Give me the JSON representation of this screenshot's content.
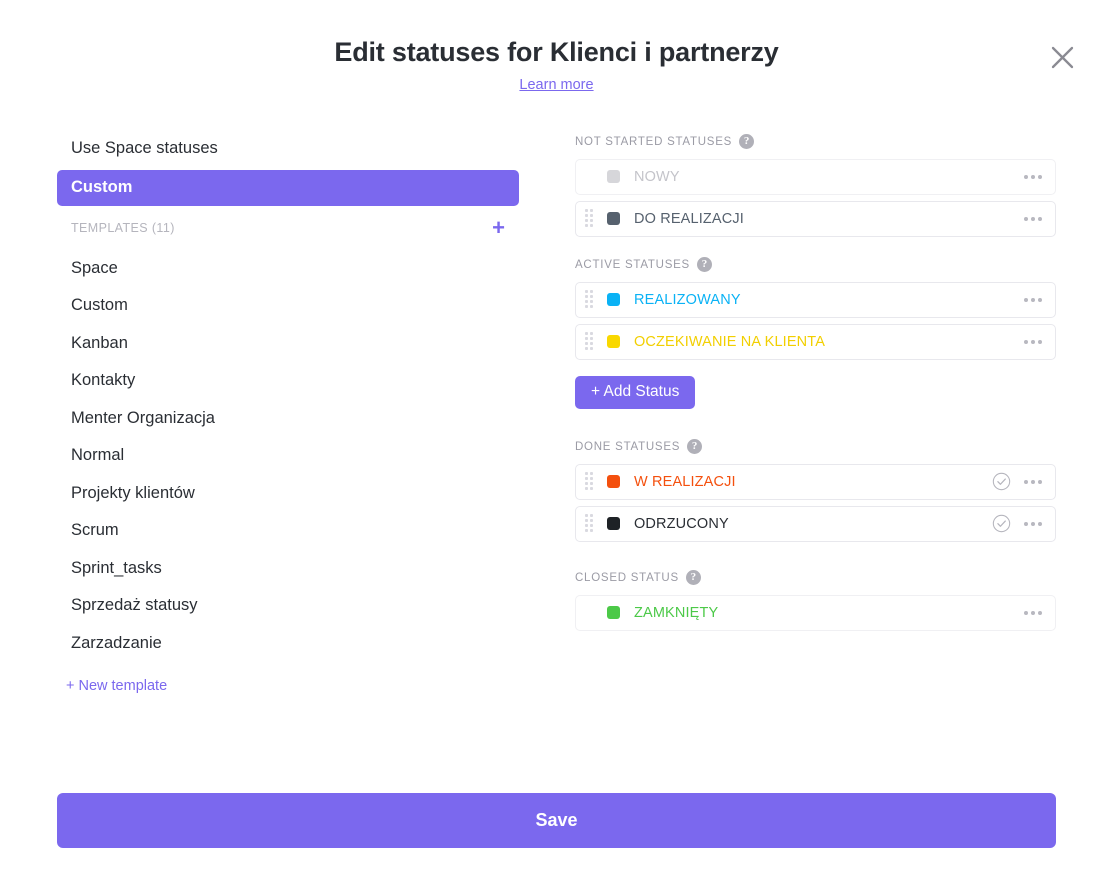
{
  "header": {
    "title": "Edit statuses for Klienci i partnerzy",
    "learn_more": "Learn more",
    "close_icon": "close-icon"
  },
  "sidebar": {
    "options": [
      {
        "label": "Use Space statuses",
        "selected": false
      },
      {
        "label": "Custom",
        "selected": true
      }
    ],
    "templates_header": {
      "label": "TEMPLATES (11)",
      "add_icon": "plus-icon"
    },
    "templates": [
      {
        "label": "Space"
      },
      {
        "label": "Custom"
      },
      {
        "label": "Kanban"
      },
      {
        "label": "Kontakty"
      },
      {
        "label": "Menter Organizacja"
      },
      {
        "label": "Normal"
      },
      {
        "label": "Projekty klientów"
      },
      {
        "label": "Scrum"
      },
      {
        "label": "Sprint_tasks"
      },
      {
        "label": "Sprzedaż statusy"
      },
      {
        "label": "Zarzadzanie"
      }
    ],
    "new_template": "+ New template"
  },
  "statuses": {
    "not_started": {
      "label": "NOT STARTED STATUSES",
      "help_icon": "help-icon",
      "rows": [
        {
          "name": "NOWY",
          "color": "#d6d6da",
          "text_color": "#c4c4ca",
          "draggable": false,
          "done_check": false
        },
        {
          "name": "DO REALIZACJI",
          "color": "#56616e",
          "text_color": "#56616e",
          "draggable": true,
          "done_check": false
        }
      ]
    },
    "active": {
      "label": "ACTIVE STATUSES",
      "help_icon": "help-icon",
      "rows": [
        {
          "name": "REALIZOWANY",
          "color": "#0ab2f5",
          "text_color": "#0ab2f5",
          "draggable": true,
          "done_check": false
        },
        {
          "name": "OCZEKIWANIE NA KLIENTA",
          "color": "#f9d800",
          "text_color": "#f2cf00",
          "draggable": true,
          "done_check": false
        }
      ],
      "add_button": "+ Add Status"
    },
    "done": {
      "label": "DONE STATUSES",
      "help_icon": "help-icon",
      "rows": [
        {
          "name": "W REALIZACJI",
          "color": "#f4500e",
          "text_color": "#f4500e",
          "draggable": true,
          "done_check": true
        },
        {
          "name": "ODRZUCONY",
          "color": "#1e2226",
          "text_color": "#2a2e34",
          "draggable": true,
          "done_check": true
        }
      ]
    },
    "closed": {
      "label": "CLOSED STATUS",
      "help_icon": "help-icon",
      "rows": [
        {
          "name": "ZAMKNIĘTY",
          "color": "#4cc948",
          "text_color": "#4cc948",
          "draggable": false,
          "done_check": false
        }
      ]
    }
  },
  "footer": {
    "save_label": "Save"
  },
  "theme": {
    "accent": "#7b68ee",
    "border": "#e8e8ed",
    "muted_text": "#9b9ba5"
  }
}
